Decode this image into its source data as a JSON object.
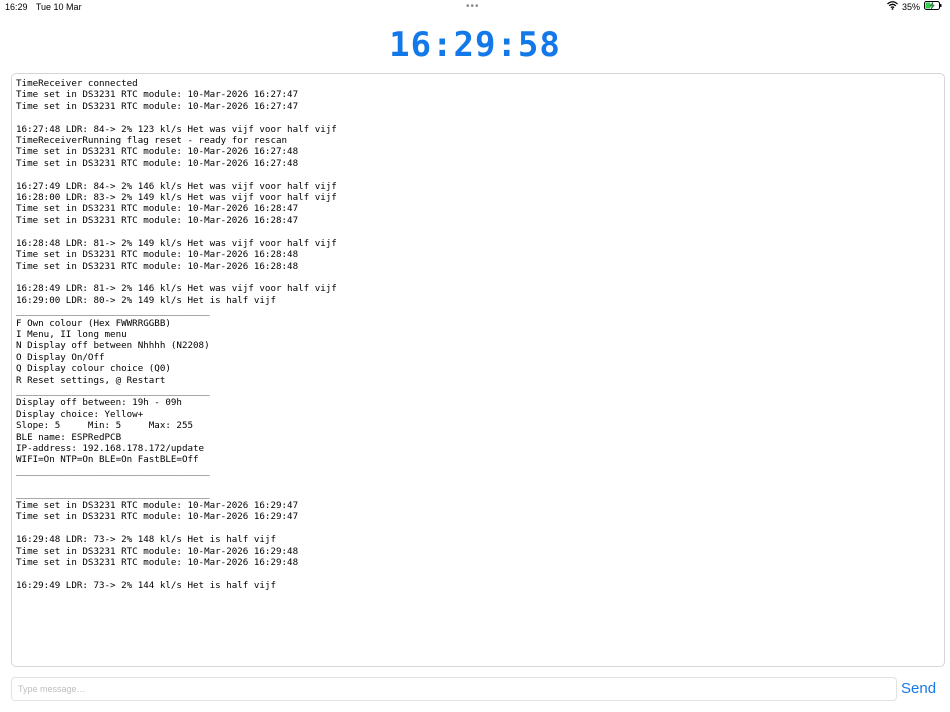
{
  "status_bar": {
    "time": "16:29",
    "date": "Tue 10 Mar",
    "dots": "•••",
    "battery_percent": "35%",
    "accent_color": "#1479e8"
  },
  "clock": {
    "time": "16:29:58"
  },
  "log": {
    "lines": [
      "TimeReceiver connected",
      "Time set in DS3231 RTC module: 10-Mar-2026 16:27:47",
      "Time set in DS3231 RTC module: 10-Mar-2026 16:27:47",
      "",
      "16:27:48 LDR: 84-> 2% 123 kl/s Het was vijf voor half vijf",
      "TimeReceiverRunning flag reset - ready for rescan",
      "Time set in DS3231 RTC module: 10-Mar-2026 16:27:48",
      "Time set in DS3231 RTC module: 10-Mar-2026 16:27:48",
      "",
      "16:27:49 LDR: 84-> 2% 146 kl/s Het was vijf voor half vijf",
      "16:28:00 LDR: 83-> 2% 149 kl/s Het was vijf voor half vijf",
      "Time set in DS3231 RTC module: 10-Mar-2026 16:28:47",
      "Time set in DS3231 RTC module: 10-Mar-2026 16:28:47",
      "",
      "16:28:48 LDR: 81-> 2% 149 kl/s Het was vijf voor half vijf",
      "Time set in DS3231 RTC module: 10-Mar-2026 16:28:48",
      "Time set in DS3231 RTC module: 10-Mar-2026 16:28:48",
      "",
      "16:28:49 LDR: 81-> 2% 146 kl/s Het was vijf voor half vijf",
      "16:29:00 LDR: 80-> 2% 149 kl/s Het is half vijf",
      "___________________________________",
      "F Own colour (Hex FWWRRGGBB)",
      "I Menu, II long menu",
      "N Display off between Nhhhh (N2208)",
      "O Display On/Off",
      "Q Display colour choice (Q0)",
      "R Reset settings, @ Restart",
      "___________________________________",
      "Display off between: 19h - 09h",
      "Display choice: Yellow+",
      "Slope: 5     Min: 5     Max: 255",
      "BLE name: ESPRedPCB",
      "IP-address: 192.168.178.172/update",
      "WIFI=On NTP=On BLE=On FastBLE=Off",
      "___________________________________",
      "",
      "___________________________________",
      "Time set in DS3231 RTC module: 10-Mar-2026 16:29:47",
      "Time set in DS3231 RTC module: 10-Mar-2026 16:29:47",
      "",
      "16:29:48 LDR: 73-> 2% 148 kl/s Het is half vijf",
      "Time set in DS3231 RTC module: 10-Mar-2026 16:29:48",
      "Time set in DS3231 RTC module: 10-Mar-2026 16:29:48",
      "",
      "16:29:49 LDR: 73-> 2% 144 kl/s Het is half vijf"
    ]
  },
  "input": {
    "placeholder": "Type message…",
    "value": ""
  },
  "send": {
    "label": "Send"
  }
}
